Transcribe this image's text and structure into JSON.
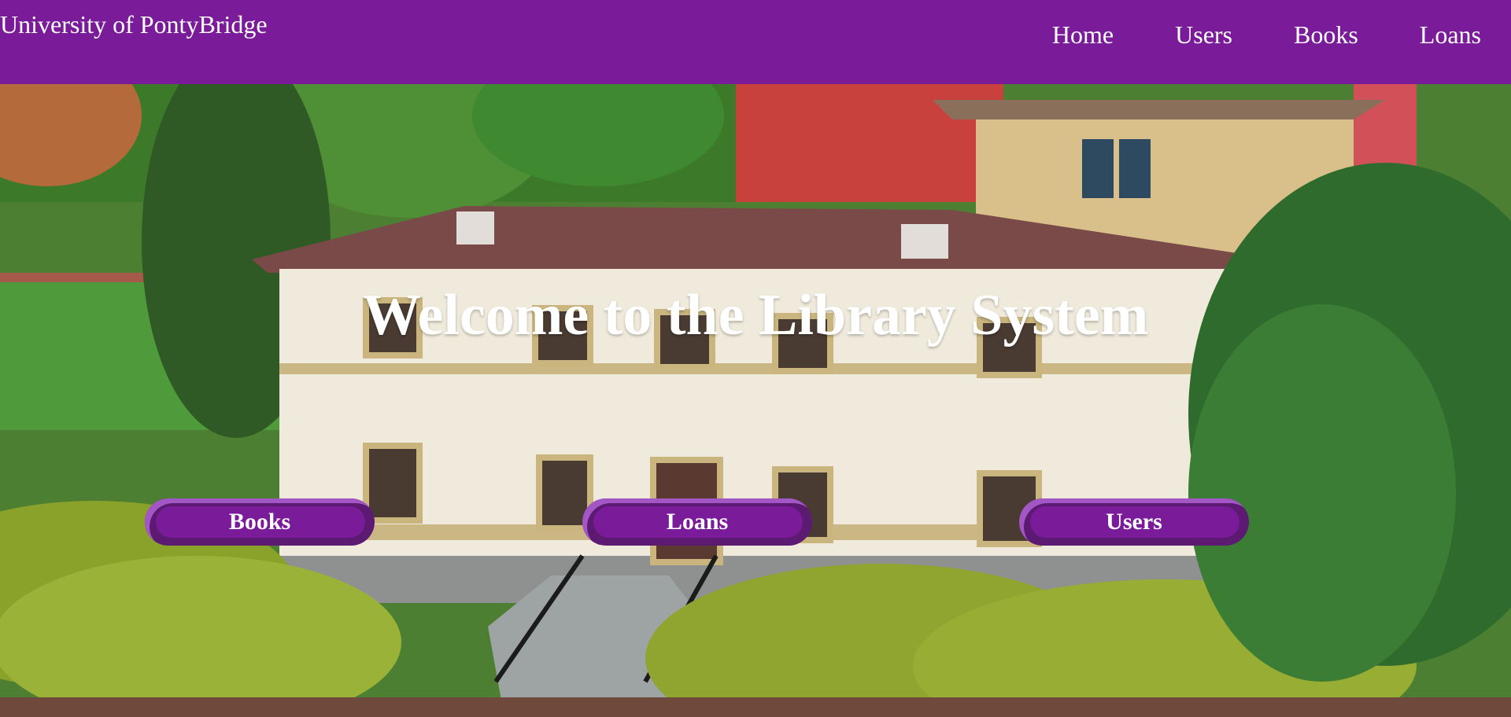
{
  "header": {
    "brand": "University of PontyBridge",
    "nav": [
      {
        "label": "Home"
      },
      {
        "label": "Users"
      },
      {
        "label": "Books"
      },
      {
        "label": "Loans"
      }
    ]
  },
  "hero": {
    "title": "Welcome to the Library System",
    "background": "miniature-building-garden-photo",
    "buttons": [
      {
        "label": "Books"
      },
      {
        "label": "Loans"
      },
      {
        "label": "Users"
      }
    ]
  },
  "colors": {
    "header_bg": "#7a1b9a",
    "button_bg": "#7a1b9a",
    "button_edge": "#5c1a73",
    "text": "#ffffff"
  }
}
